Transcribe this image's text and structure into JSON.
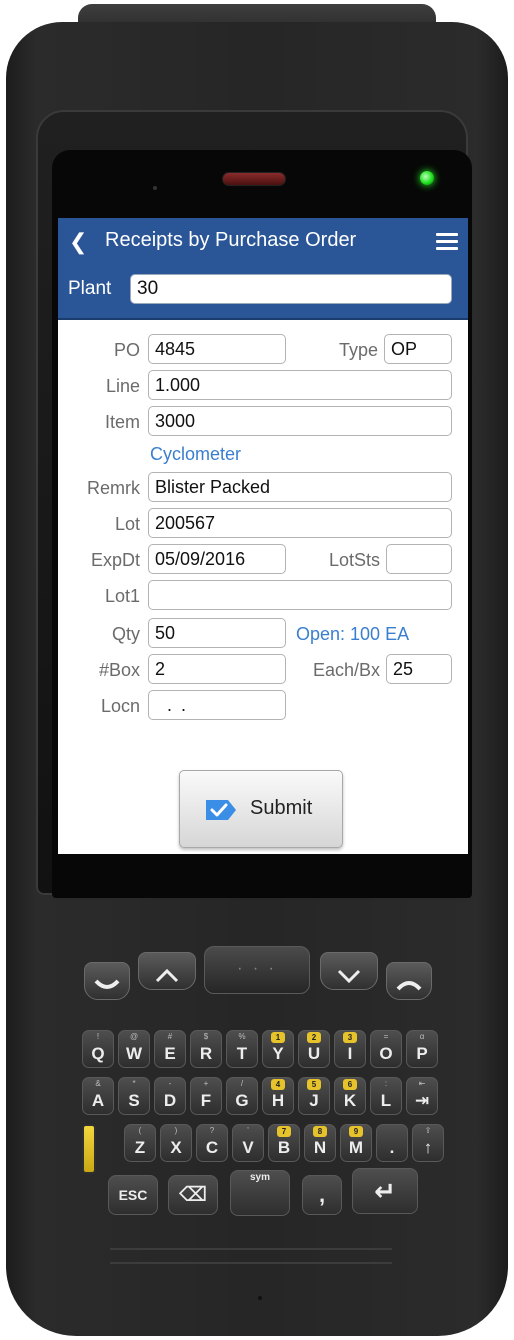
{
  "app": {
    "title": "Receipts by Purchase Order",
    "back_icon": "chevron-left-icon",
    "menu_icon": "hamburger-menu-icon",
    "header_color": "#2a5698"
  },
  "plant": {
    "label": "Plant",
    "value": "30"
  },
  "form": {
    "po": {
      "label": "PO",
      "value": "4845"
    },
    "type": {
      "label": "Type",
      "value": "OP"
    },
    "line": {
      "label": "Line",
      "value": "1.000"
    },
    "item": {
      "label": "Item",
      "value": "3000"
    },
    "item_description": "Cyclometer",
    "remark": {
      "label": "Remrk",
      "value": "Blister Packed"
    },
    "lot": {
      "label": "Lot",
      "value": "200567"
    },
    "exp_date": {
      "label": "ExpDt",
      "value": "05/09/2016"
    },
    "lot_status": {
      "label": "LotSts",
      "value": ""
    },
    "lot1": {
      "label": "Lot1",
      "value": ""
    },
    "qty": {
      "label": "Qty",
      "value": "50"
    },
    "open_qty": "Open: 100 EA",
    "boxes": {
      "label": "#Box",
      "value": "2"
    },
    "each_per_box": {
      "label": "Each/Bx",
      "value": "25"
    },
    "location": {
      "label": "Locn",
      "value": ".  ."
    }
  },
  "submit": {
    "label": "Submit",
    "icon": "checkmark-tag-icon",
    "accent": "#3b8ee6"
  },
  "keypad": {
    "scan_label": "· · ·",
    "row1": [
      {
        "main": "Q",
        "sub": "!"
      },
      {
        "main": "W",
        "sub": "@"
      },
      {
        "main": "E",
        "sub": "#"
      },
      {
        "main": "R",
        "sub": "$"
      },
      {
        "main": "T",
        "sub": "%"
      },
      {
        "main": "Y",
        "sub": "1"
      },
      {
        "main": "U",
        "sub": "2"
      },
      {
        "main": "I",
        "sub": "3"
      },
      {
        "main": "O",
        "sub": "="
      },
      {
        "main": "P",
        "sub": "α"
      }
    ],
    "row2": [
      {
        "main": "A",
        "sub": "&"
      },
      {
        "main": "S",
        "sub": "*"
      },
      {
        "main": "D",
        "sub": "-"
      },
      {
        "main": "F",
        "sub": "+"
      },
      {
        "main": "G",
        "sub": "/"
      },
      {
        "main": "H",
        "sub": "4"
      },
      {
        "main": "J",
        "sub": "5"
      },
      {
        "main": "K",
        "sub": "6"
      },
      {
        "main": "L",
        "sub": ":"
      },
      {
        "main": "⇥",
        "sub": "⇤"
      }
    ],
    "row3": [
      {
        "main": "Z",
        "sub": "("
      },
      {
        "main": "X",
        "sub": ")"
      },
      {
        "main": "C",
        "sub": "?"
      },
      {
        "main": "V",
        "sub": "'"
      },
      {
        "main": "B",
        "sub": "7"
      },
      {
        "main": "N",
        "sub": "8"
      },
      {
        "main": "M",
        "sub": "9"
      },
      {
        "main": ".",
        "sub": ""
      },
      {
        "main": "↑",
        "sub": "⇪"
      }
    ],
    "esc_label": "ESC",
    "backspace_label": "⌫",
    "space_label": "sym",
    "comma_label": ",",
    "comma_sub": "0",
    "enter_label": "↵"
  }
}
